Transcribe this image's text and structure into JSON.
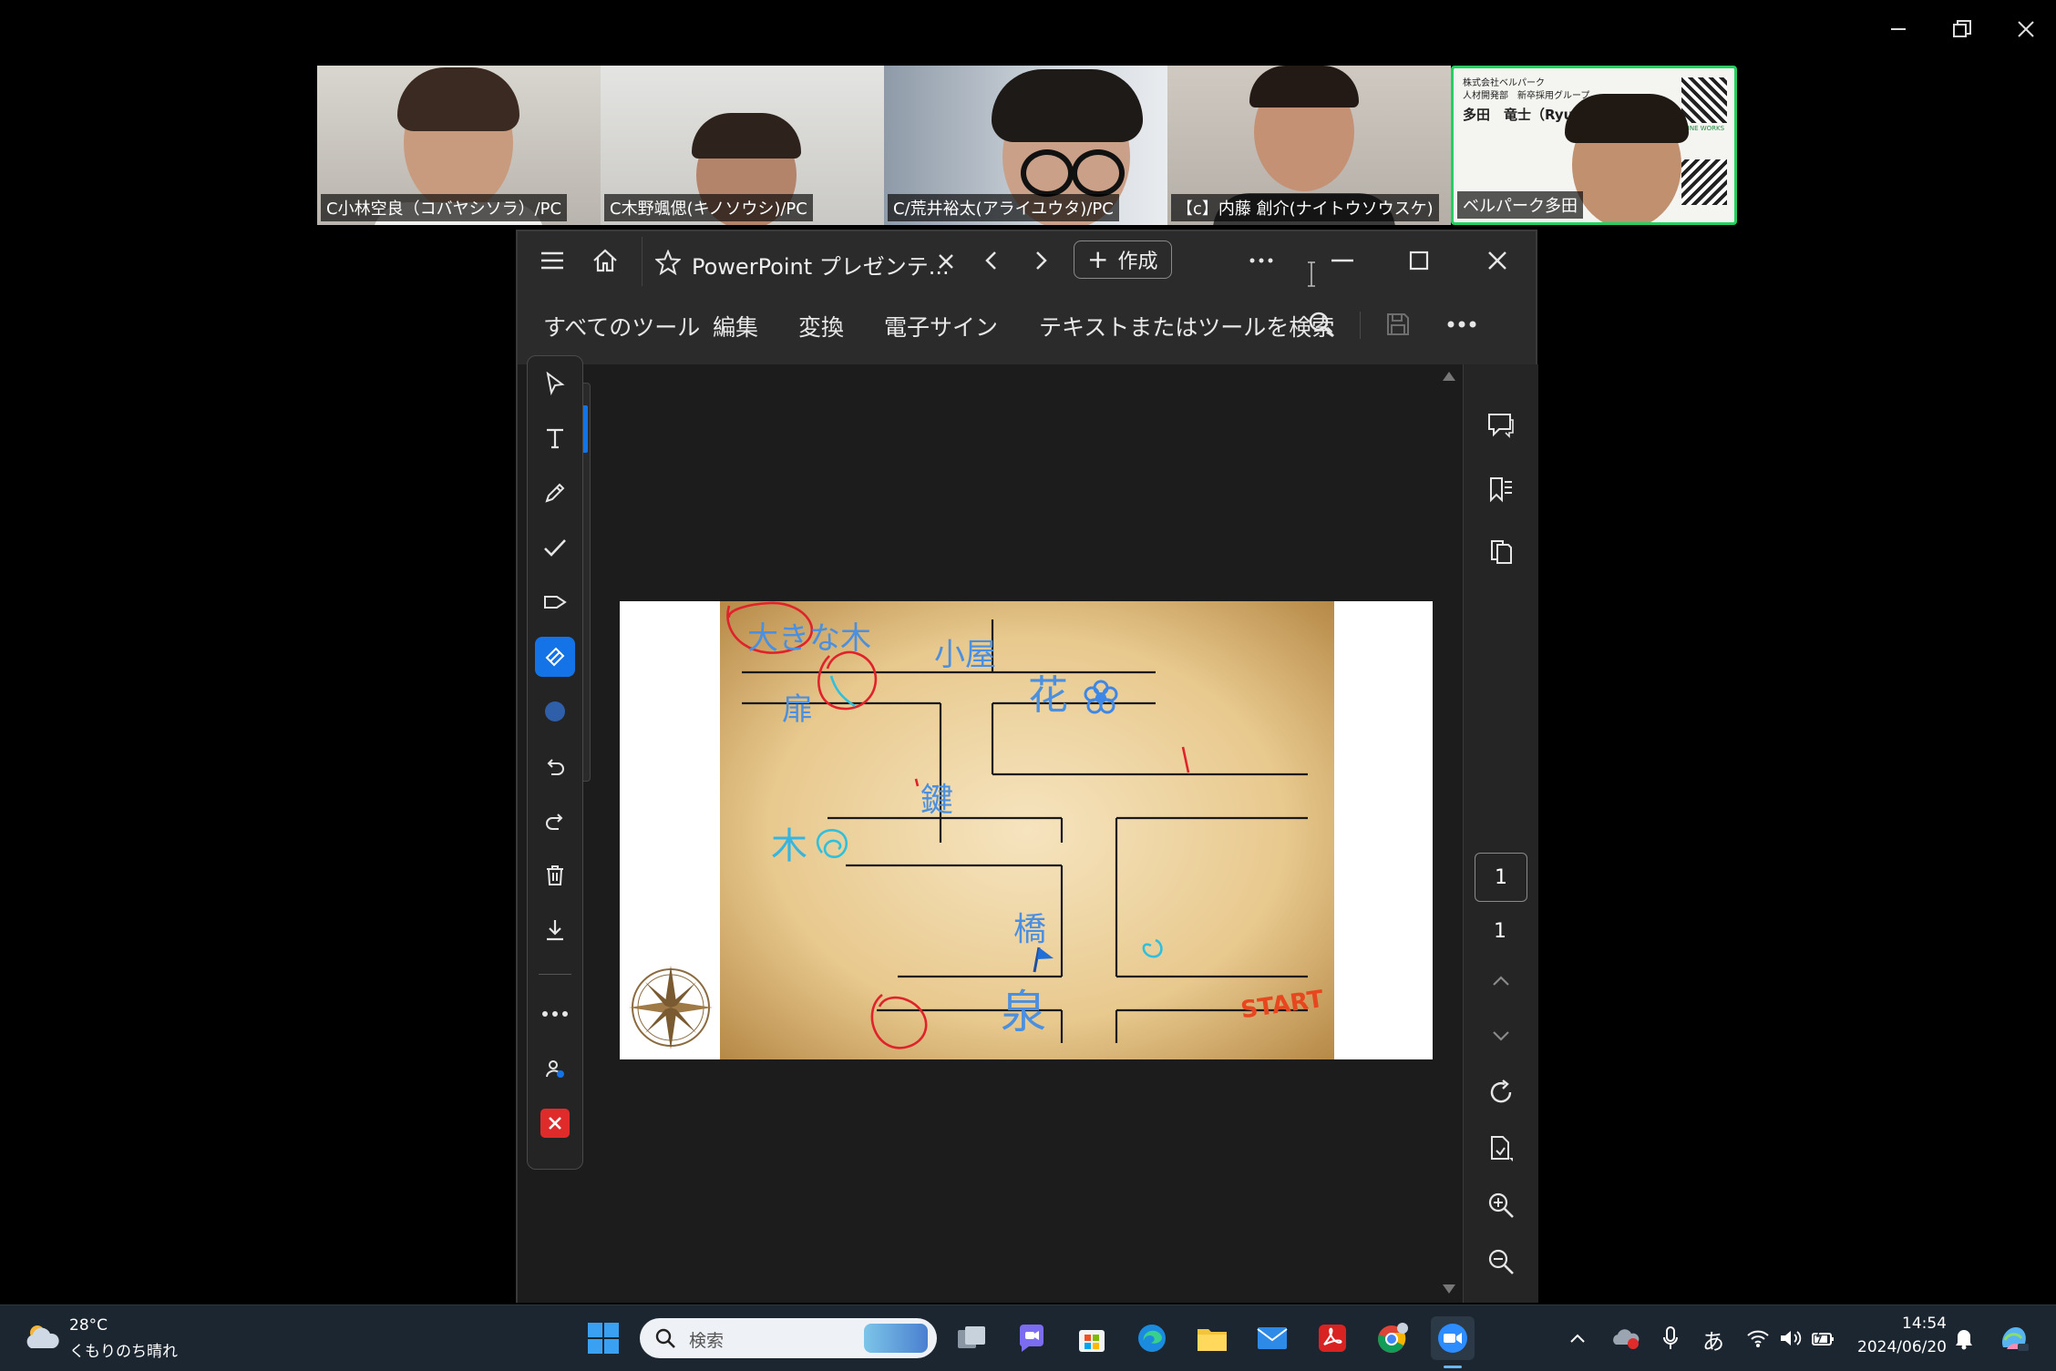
{
  "participants": [
    {
      "name": "C小林空良（コバヤシソラ）/PC"
    },
    {
      "name": "C木野颯偲(キノソウシ)/PC"
    },
    {
      "name": "C/荒井裕太(アライユウタ)/PC"
    },
    {
      "name": "【c】内藤 創介(ナイトウソウスケ)"
    },
    {
      "name": "ベルパーク多田"
    }
  ],
  "business_card": {
    "company": "株式会社ベルパーク",
    "dept": "人材開発部　新卒採用グループ",
    "person": "多田　竜士（Ryuji",
    "badge": "LINE WORKS"
  },
  "acrobat": {
    "tab_title": "PowerPoint プレゼンテ...",
    "create_label": "作成",
    "toolbar": {
      "all_tools": "すべてのツール",
      "edit": "編集",
      "convert": "変換",
      "esign": "電子サイン",
      "search_placeholder": "テキストまたはツールを検索"
    },
    "page_current": "1",
    "page_total": "1"
  },
  "slide": {
    "labels": {
      "big_tree": "大きな木",
      "hut": "小屋",
      "flower": "花",
      "door": "扉",
      "key": "鍵",
      "tree": "木",
      "bridge": "橋",
      "spring": "泉",
      "start": "START"
    }
  },
  "taskbar": {
    "weather_temp": "28°C",
    "weather_desc": "くもりのち晴れ",
    "search_placeholder": "検索",
    "ime": "あ",
    "time": "14:54",
    "date": "2024/06/20"
  },
  "colors": {
    "accent_blue": "#1473e6",
    "active_speaker": "#23d160",
    "close_red": "#e02b2b",
    "taskbar": "#1b2630"
  }
}
